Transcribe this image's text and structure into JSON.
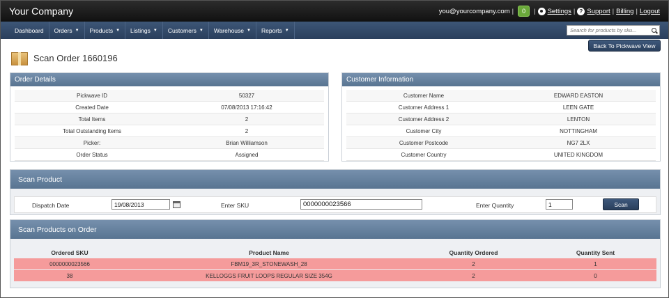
{
  "topbar": {
    "brand": "Your Company",
    "email": "you@yourcompany.com",
    "badge_count": "0",
    "settings_label": "Settings",
    "support_label": "Support",
    "billing_label": "Billing",
    "logout_label": "Logout"
  },
  "nav": {
    "items": [
      {
        "label": "Dashboard",
        "caret": ""
      },
      {
        "label": "Orders",
        "caret": "▼"
      },
      {
        "label": "Products",
        "caret": "▼"
      },
      {
        "label": "Listings",
        "caret": "▼"
      },
      {
        "label": "Customers",
        "caret": "▼"
      },
      {
        "label": "Warehouse",
        "caret": "▼"
      },
      {
        "label": "Reports",
        "caret": "▼"
      }
    ],
    "search_placeholder": "Search for products by sku..."
  },
  "page": {
    "title": "Scan Order 1660196",
    "back_button": "Back To Pickwave View"
  },
  "order_details": {
    "heading": "Order Details",
    "rows": [
      {
        "label": "Pickwave ID",
        "value": "50327"
      },
      {
        "label": "Created Date",
        "value": "07/08/2013 17:16:42"
      },
      {
        "label": "Total Items",
        "value": "2"
      },
      {
        "label": "Total Outstanding Items",
        "value": "2"
      },
      {
        "label": "Picker:",
        "value": "Brian Williamson"
      },
      {
        "label": "Order Status",
        "value": "Assigned"
      }
    ]
  },
  "customer_info": {
    "heading": "Customer Information",
    "rows": [
      {
        "label": "Customer Name",
        "value": "EDWARD EASTON"
      },
      {
        "label": "Customer Address 1",
        "value": "LEEN GATE"
      },
      {
        "label": "Customer Address 2",
        "value": "LENTON"
      },
      {
        "label": "Customer City",
        "value": "NOTTINGHAM"
      },
      {
        "label": "Customer Postcode",
        "value": "NG7 2LX"
      },
      {
        "label": "Customer Country",
        "value": "UNITED KINGDOM"
      }
    ]
  },
  "scan_product": {
    "heading": "Scan Product",
    "dispatch_label": "Dispatch Date",
    "dispatch_value": "19/08/2013",
    "sku_label": "Enter SKU",
    "sku_value": "0000000023566",
    "qty_label": "Enter Quantity",
    "qty_value": "1",
    "scan_button": "Scan"
  },
  "scan_products_on_order": {
    "heading": "Scan Products on Order",
    "columns": [
      "Ordered SKU",
      "Product Name",
      "Quantity Ordered",
      "Quantity Sent"
    ],
    "rows": [
      {
        "sku": "0000000023566",
        "name": "FBM19_3R_STONEWASH_28",
        "ordered": "2",
        "sent": "1"
      },
      {
        "sku": "38",
        "name": "KELLOGGS FRUIT LOOPS REGULAR SIZE 354G",
        "ordered": "2",
        "sent": "0"
      }
    ],
    "row_color": "#f59b9b"
  }
}
